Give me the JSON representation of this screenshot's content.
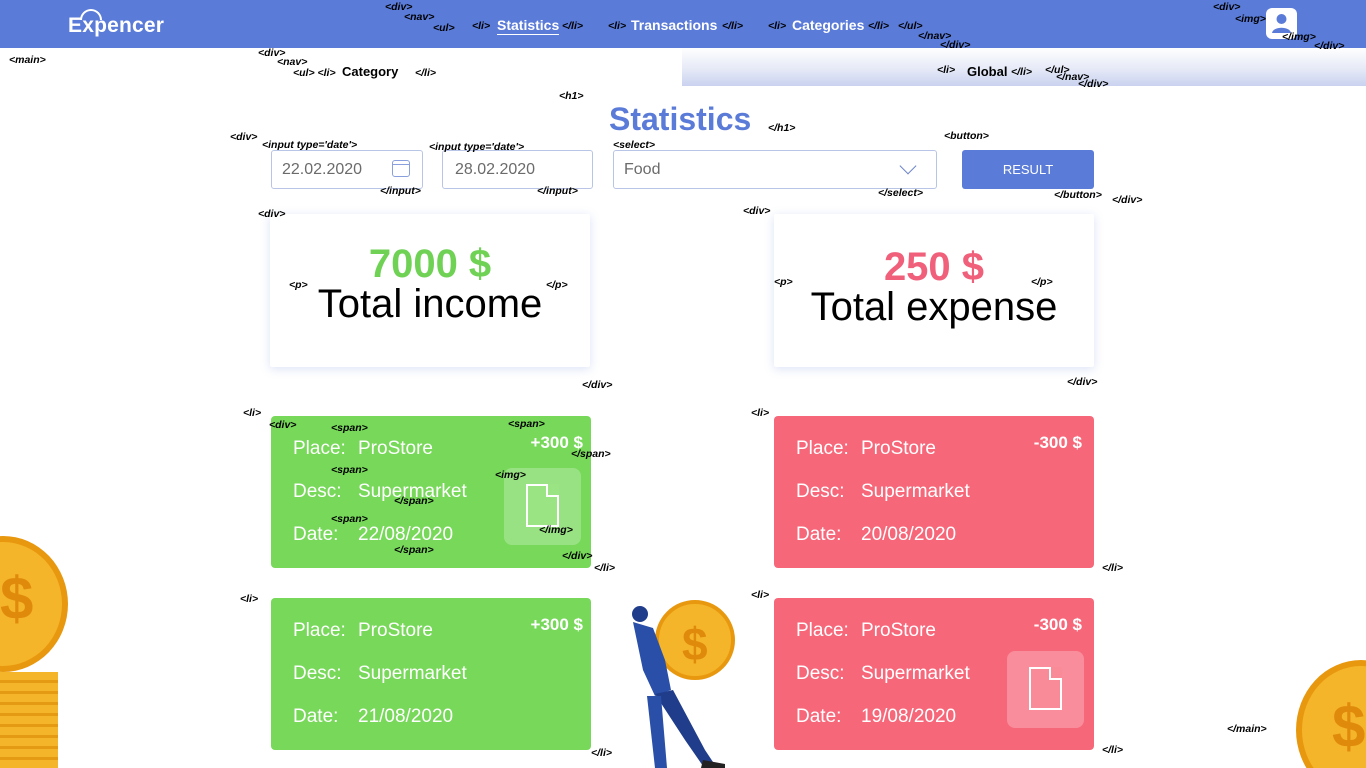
{
  "header": {
    "logo": "Expencer",
    "nav": [
      "Statistics",
      "Transactions",
      "Categories"
    ]
  },
  "subnav": {
    "left": "Category",
    "right": "Global"
  },
  "page_title": "Statistics",
  "filters": {
    "date_from": "22.02.2020",
    "date_to": "28.02.2020",
    "category": "Food",
    "button": "RESULT"
  },
  "summary": {
    "income_amount": "7000 $",
    "income_label": "Total income",
    "expense_amount": "250 $",
    "expense_label": "Total expense"
  },
  "transactions": {
    "labels": {
      "place": "Place:",
      "desc": "Desc:",
      "date": "Date:"
    },
    "income": [
      {
        "place": "ProStore",
        "desc": "Supermarket",
        "date": "22/08/2020",
        "amount": "+300 $"
      },
      {
        "place": "ProStore",
        "desc": "Supermarket",
        "date": "21/08/2020",
        "amount": "+300 $"
      }
    ],
    "expense": [
      {
        "place": "ProStore",
        "desc": "Supermarket",
        "date": "20/08/2020",
        "amount": "-300 $"
      },
      {
        "place": "ProStore",
        "desc": "Supermarket",
        "date": "19/08/2020",
        "amount": "-300 $"
      }
    ]
  },
  "colors": {
    "primary": "#5a7bd8",
    "income": "#77d85a",
    "income_text": "#6fd255",
    "expense": "#f7677a",
    "expense_text": "#f0607a"
  },
  "icons": [
    "calendar-icon",
    "chevron-down-icon",
    "document-icon",
    "user-icon",
    "coin-icon"
  ],
  "tags": {
    "div": "<div>",
    "div_end": "</div>",
    "nav": "<nav>",
    "nav_end": "</nav>",
    "ul": "<ul>",
    "ul_end": "</ul>",
    "li": "<li>",
    "li_end": "</li>",
    "img": "<img>",
    "img_end": "</img>",
    "main": "<main>",
    "main_end": "</main>",
    "h1": "<h1>",
    "h1_end": "</h1>",
    "p": "<p>",
    "p_end": "</p>",
    "span": "<span>",
    "span_end": "</span>",
    "input_date": "<input type='date'>",
    "input_end": "</input>",
    "select": "<select>",
    "select_end": "</select>",
    "button": "<button>",
    "button_end": "</button>",
    "ul_li": "<ul> <li>",
    "li_end_ul_end": "</li> </ul>"
  }
}
